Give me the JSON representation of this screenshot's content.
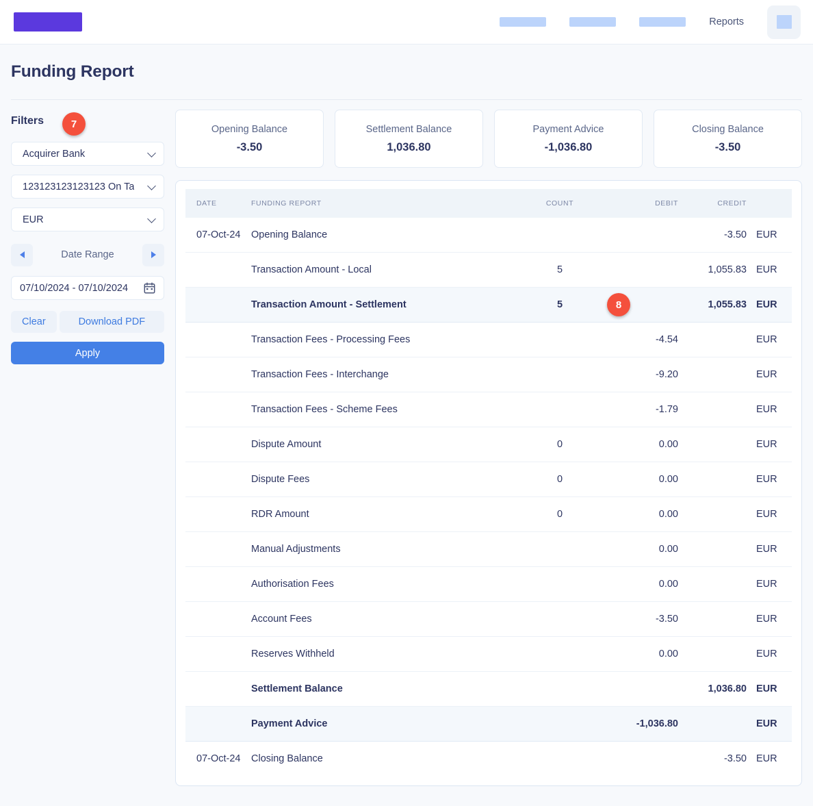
{
  "navbar": {
    "logo_color": "#5B39DE",
    "redacted_items": [
      "",
      "",
      ""
    ],
    "links": [
      "Reports"
    ],
    "icon_button": "redacted-icon-button"
  },
  "page": {
    "title": "Funding Report"
  },
  "filters": {
    "title": "Filters",
    "marker": "7",
    "acquirer_select": {
      "value": "Acquirer Bank",
      "icon": "chevron-down-icon"
    },
    "account_select": {
      "value": "123123123123123 On Ta",
      "icon": "chevron-down-icon"
    },
    "currency_select": {
      "value": "EUR",
      "icon": "chevron-down-icon"
    },
    "date_range": {
      "label": "Date Range",
      "prev_icon": "chevron-left-icon",
      "next_icon": "chevron-right-icon",
      "value": "07/10/2024 - 07/10/2024",
      "calendar_icon": "calendar-icon"
    },
    "clear_label": "Clear",
    "download_label": "Download PDF",
    "apply_label": "Apply"
  },
  "summary_cards": [
    {
      "label": "Opening Balance",
      "value": "-3.50"
    },
    {
      "label": "Settlement Balance",
      "value": "1,036.80"
    },
    {
      "label": "Payment Advice",
      "value": "-1,036.80"
    },
    {
      "label": "Closing Balance",
      "value": "-3.50"
    }
  ],
  "table": {
    "columns": [
      "DATE",
      "FUNDING REPORT",
      "COUNT",
      "DEBIT",
      "CREDIT",
      ""
    ],
    "row_marker": "8",
    "rows": [
      {
        "date": "07-Oct-24",
        "desc": "Opening Balance",
        "count": "",
        "debit": "",
        "credit": "-3.50",
        "currency": "EUR",
        "bold": false,
        "highlight": false,
        "marker": ""
      },
      {
        "date": "",
        "desc": "Transaction Amount - Local",
        "count": "5",
        "debit": "",
        "credit": "1,055.83",
        "currency": "EUR",
        "bold": false,
        "highlight": false,
        "marker": ""
      },
      {
        "date": "",
        "desc": "Transaction Amount - Settlement",
        "count": "5",
        "debit": "",
        "credit": "1,055.83",
        "currency": "EUR",
        "bold": true,
        "highlight": true,
        "marker": "8"
      },
      {
        "date": "",
        "desc": "Transaction Fees - Processing Fees",
        "count": "",
        "debit": "-4.54",
        "credit": "",
        "currency": "EUR",
        "bold": false,
        "highlight": false,
        "marker": ""
      },
      {
        "date": "",
        "desc": "Transaction Fees - Interchange",
        "count": "",
        "debit": "-9.20",
        "credit": "",
        "currency": "EUR",
        "bold": false,
        "highlight": false,
        "marker": ""
      },
      {
        "date": "",
        "desc": "Transaction Fees - Scheme Fees",
        "count": "",
        "debit": "-1.79",
        "credit": "",
        "currency": "EUR",
        "bold": false,
        "highlight": false,
        "marker": ""
      },
      {
        "date": "",
        "desc": "Dispute Amount",
        "count": "0",
        "debit": "0.00",
        "credit": "",
        "currency": "EUR",
        "bold": false,
        "highlight": false,
        "marker": ""
      },
      {
        "date": "",
        "desc": "Dispute Fees",
        "count": "0",
        "debit": "0.00",
        "credit": "",
        "currency": "EUR",
        "bold": false,
        "highlight": false,
        "marker": ""
      },
      {
        "date": "",
        "desc": "RDR Amount",
        "count": "0",
        "debit": "0.00",
        "credit": "",
        "currency": "EUR",
        "bold": false,
        "highlight": false,
        "marker": ""
      },
      {
        "date": "",
        "desc": "Manual Adjustments",
        "count": "",
        "debit": "0.00",
        "credit": "",
        "currency": "EUR",
        "bold": false,
        "highlight": false,
        "marker": ""
      },
      {
        "date": "",
        "desc": "Authorisation Fees",
        "count": "",
        "debit": "0.00",
        "credit": "",
        "currency": "EUR",
        "bold": false,
        "highlight": false,
        "marker": ""
      },
      {
        "date": "",
        "desc": "Account Fees",
        "count": "",
        "debit": "-3.50",
        "credit": "",
        "currency": "EUR",
        "bold": false,
        "highlight": false,
        "marker": ""
      },
      {
        "date": "",
        "desc": "Reserves Withheld",
        "count": "",
        "debit": "0.00",
        "credit": "",
        "currency": "EUR",
        "bold": false,
        "highlight": false,
        "marker": ""
      },
      {
        "date": "",
        "desc": "Settlement Balance",
        "count": "",
        "debit": "",
        "credit": "1,036.80",
        "currency": "EUR",
        "bold": true,
        "highlight": false,
        "marker": ""
      },
      {
        "date": "",
        "desc": "Payment Advice",
        "count": "",
        "debit": "-1,036.80",
        "credit": "",
        "currency": "EUR",
        "bold": true,
        "highlight": true,
        "marker": ""
      },
      {
        "date": "07-Oct-24",
        "desc": "Closing Balance",
        "count": "",
        "debit": "",
        "credit": "-3.50",
        "currency": "EUR",
        "bold": false,
        "highlight": false,
        "marker": ""
      }
    ]
  },
  "colors": {
    "brand": "#5B39DE",
    "accent": "#4480E6",
    "marker": "#F4503C",
    "text": "#2D3561"
  }
}
